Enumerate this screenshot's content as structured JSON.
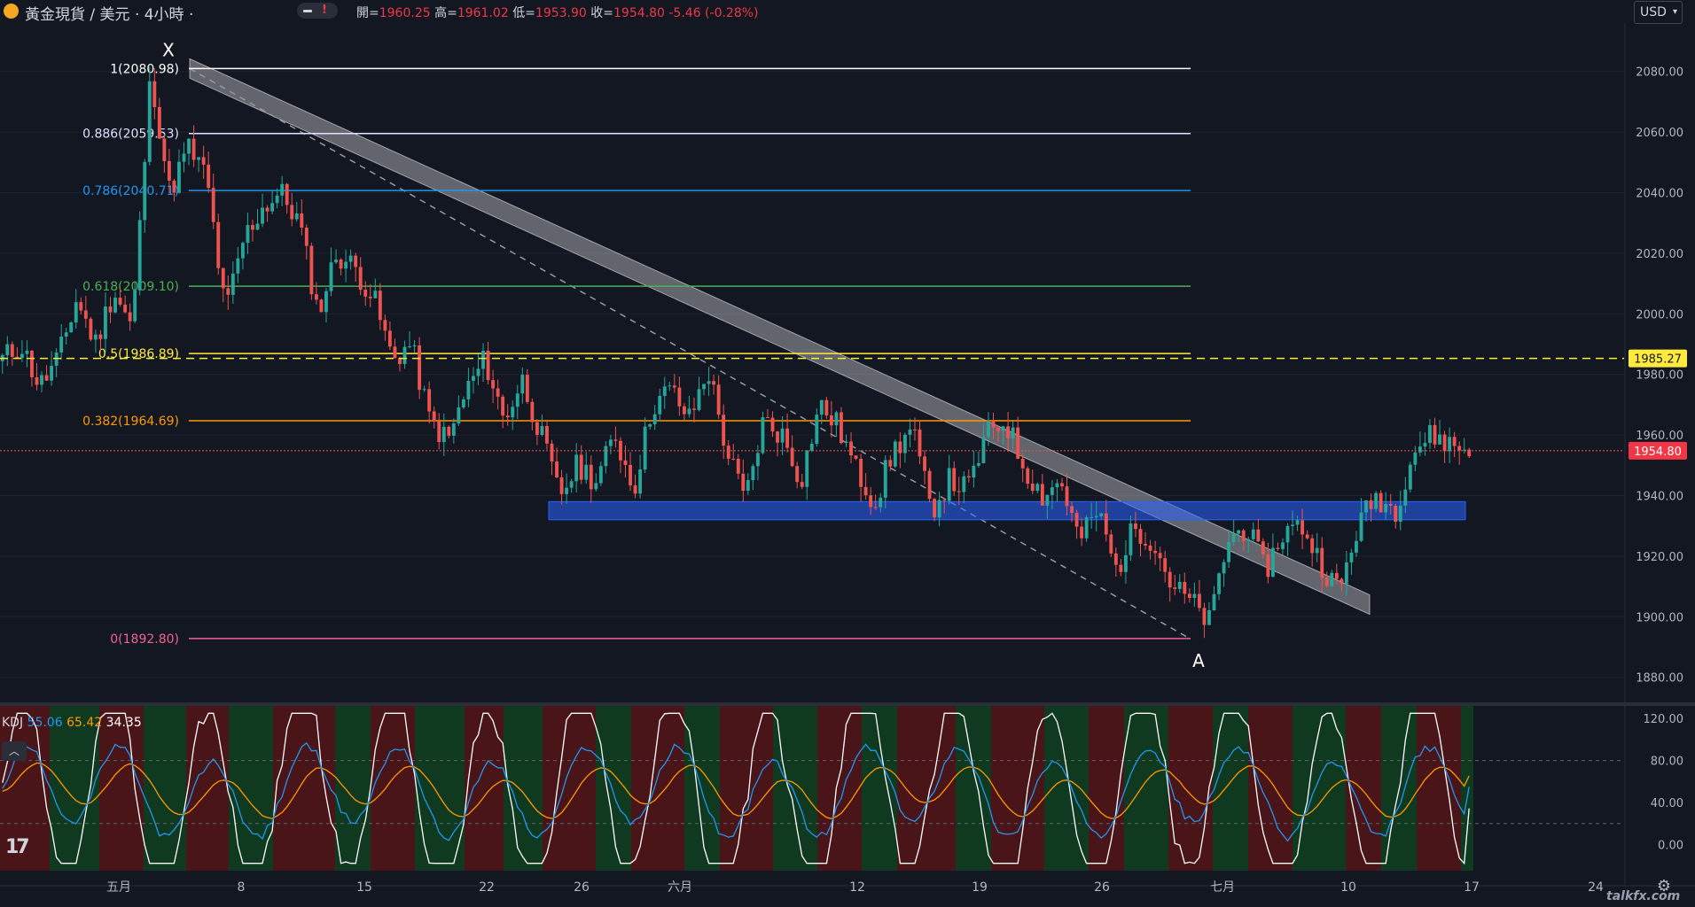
{
  "header": {
    "title": "黃金現貨 / 美元 · 4小時 ·",
    "ohlc": [
      {
        "label": "開=",
        "value": "1960.25"
      },
      {
        "label": "高=",
        "value": "1961.02"
      },
      {
        "label": "低=",
        "value": "1953.90"
      },
      {
        "label": "收=",
        "value": "1954.80"
      },
      {
        "label": "",
        "value": "-5.46 (-0.28%)"
      }
    ]
  },
  "currency_label": "USD",
  "kdj_legend": {
    "name": "KDJ",
    "k": "55.06",
    "d": "65.42",
    "j": "34.35"
  },
  "watermark": "talkfx.com",
  "colors": {
    "up": "#26a69a",
    "down": "#ef5350",
    "k": "#2196f3",
    "d": "#ff9800",
    "j": "#ffffff",
    "zone": "#2962ff"
  },
  "chart_data": [
    {
      "type": "candlestick",
      "title": "",
      "y_axis_labels": [
        "2080.00",
        "2060.00",
        "2040.00",
        "2020.00",
        "2000.00",
        "1980.00",
        "1960.00",
        "1940.00",
        "1920.00",
        "1900.00",
        "1880.00"
      ],
      "y_axis_values": [
        2080,
        2060,
        2040,
        2020,
        2000,
        1980,
        1960,
        1940,
        1920,
        1900,
        1880
      ],
      "ylim": [
        1872,
        2096
      ],
      "x_axis_labels": [
        "五月",
        "8",
        "15",
        "22",
        "26",
        "六月",
        "12",
        "19",
        "26",
        "七月",
        "10",
        "17",
        "24"
      ],
      "price_current": "1954.80",
      "price_current_value": 1954.8,
      "price_marker": "1985.27",
      "price_marker_value": 1985.27,
      "fib_levels": [
        {
          "text": "1(2080.98)",
          "value": 2080.98,
          "color": "#ffffff"
        },
        {
          "text": "0.886(2059.53)",
          "value": 2059.53,
          "color": "#e0e0ff"
        },
        {
          "text": "0.786(2040.71)",
          "value": 2040.71,
          "color": "#2196f3"
        },
        {
          "text": "0.618(2009.10)",
          "value": 2009.1,
          "color": "#4caf50"
        },
        {
          "text": "0.5(1986.89)",
          "value": 1986.89,
          "color": "#ffeb3b"
        },
        {
          "text": "0.382(1964.69)",
          "value": 1964.69,
          "color": "#ff9800"
        },
        {
          "text": "0(1892.80)",
          "value": 1892.8,
          "color": "#f06292"
        }
      ],
      "points": [
        {
          "label": "X",
          "value": 2080.98
        },
        {
          "label": "A",
          "value": 1892.8
        }
      ],
      "zone": {
        "from": 1932,
        "to": 1938
      },
      "trend_channel": {
        "start": 2080.98,
        "end": 1904
      },
      "key_prices": [
        1985,
        1990,
        1976,
        1985,
        2005,
        1990,
        2008,
        1995,
        2080,
        2040,
        2055,
        2045,
        2000,
        2025,
        2035,
        2040,
        2030,
        2000,
        2020,
        2015,
        2005,
        1985,
        1990,
        1965,
        1958,
        1975,
        1985,
        1965,
        1978,
        1960,
        1940,
        1950,
        1945,
        1960,
        1942,
        1970,
        1975,
        1965,
        1982,
        1955,
        1938,
        1965,
        1960,
        1945,
        1970,
        1963,
        1948,
        1938,
        1955,
        1962,
        1935,
        1945,
        1942,
        1960,
        1965,
        1950,
        1940,
        1945,
        1925,
        1935,
        1915,
        1930,
        1925,
        1910,
        1905,
        1898,
        1925,
        1930,
        1915,
        1928,
        1930,
        1918,
        1908,
        1930,
        1940,
        1935,
        1955,
        1960,
        1957,
        1954.8
      ]
    },
    {
      "type": "line",
      "title": "KDJ",
      "y_axis_labels": [
        "120.00",
        "80.00",
        "40.00",
        "0.00"
      ],
      "y_axis_values": [
        120,
        80,
        40,
        0
      ],
      "ylim": [
        -25,
        132
      ],
      "series": [
        {
          "name": "K",
          "last": 55.06
        },
        {
          "name": "D",
          "last": 65.42
        },
        {
          "name": "J",
          "last": 34.35
        }
      ]
    }
  ]
}
